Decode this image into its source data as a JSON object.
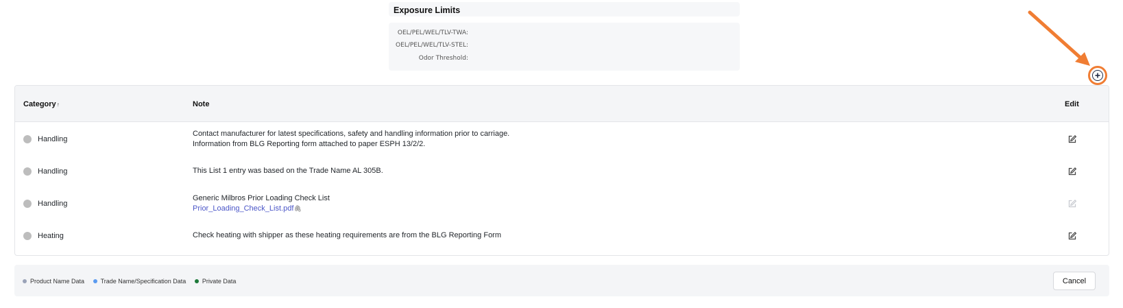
{
  "exposure": {
    "title": "Exposure Limits",
    "rows": [
      {
        "label": "OEL/PEL/WEL/TLV-TWA:"
      },
      {
        "label": "OEL/PEL/WEL/TLV-STEL:"
      },
      {
        "label": "Odor Threshold:"
      }
    ]
  },
  "add_button": {
    "icon": "plus-circle-icon",
    "annotation_color": "#f07d33"
  },
  "table": {
    "headers": {
      "category": "Category",
      "sort_glyph": "↑",
      "note": "Note",
      "edit": "Edit"
    },
    "rows": [
      {
        "category": "Handling",
        "status_color": "#bdbdbd",
        "note_lines": [
          "Contact manufacturer for latest specifications, safety and handling information prior to carriage.",
          "Information from BLG Reporting form attached to paper ESPH 13/2/2."
        ],
        "edit_enabled": true
      },
      {
        "category": "Handling",
        "status_color": "#bdbdbd",
        "note_lines": [
          "This List 1 entry was based on the Trade Name AL 305B."
        ],
        "edit_enabled": true
      },
      {
        "category": "Handling",
        "status_color": "#bdbdbd",
        "note_lines": [
          "Generic Milbros Prior Loading Check List"
        ],
        "attachment": "Prior_Loading_Check_List.pdf",
        "edit_enabled": false
      },
      {
        "category": "Heating",
        "status_color": "#bdbdbd",
        "note_lines": [
          "Check heating with shipper as these heating requirements are from the BLG Reporting Form"
        ],
        "edit_enabled": true
      }
    ]
  },
  "footer": {
    "legend": [
      {
        "label": "Product Name Data",
        "color": "#9aa3b8"
      },
      {
        "label": "Trade Name/Specification Data",
        "color": "#5b9bf0"
      },
      {
        "label": "Private Data",
        "color": "#1e7a3a"
      }
    ],
    "cancel_label": "Cancel"
  }
}
